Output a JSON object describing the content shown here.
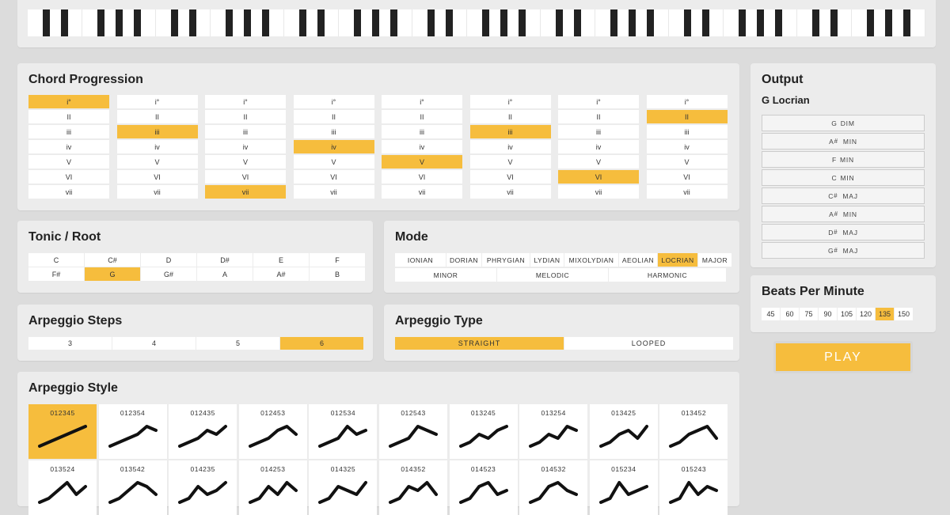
{
  "chord_progression": {
    "title": "Chord Progression",
    "degrees": [
      "i°",
      "II",
      "iii",
      "iv",
      "V",
      "VI",
      "vii"
    ],
    "selected": [
      0,
      2,
      6,
      3,
      4,
      2,
      5,
      1
    ]
  },
  "tonic": {
    "title": "Tonic / Root",
    "notes": [
      "C",
      "C#",
      "D",
      "D#",
      "E",
      "F",
      "F#",
      "G",
      "G#",
      "A",
      "A#",
      "B"
    ],
    "selected": 7
  },
  "mode": {
    "title": "Mode",
    "row1": [
      "IONIAN",
      "DORIAN",
      "PHRYGIAN",
      "LYDIAN",
      "MIXOLYDIAN",
      "AEOLIAN",
      "LOCRIAN",
      "MAJOR"
    ],
    "row2": [
      "MINOR",
      "MELODIC",
      "HARMONIC"
    ],
    "selected": "LOCRIAN"
  },
  "output": {
    "title": "Output",
    "key_name": "G Locrian",
    "chords": [
      {
        "root": "G",
        "accidental": "",
        "quality": "DIM"
      },
      {
        "root": "A",
        "accidental": "#",
        "quality": "MIN"
      },
      {
        "root": "F",
        "accidental": "",
        "quality": "MIN"
      },
      {
        "root": "C",
        "accidental": "",
        "quality": "MIN"
      },
      {
        "root": "C",
        "accidental": "#",
        "quality": "MAJ"
      },
      {
        "root": "A",
        "accidental": "#",
        "quality": "MIN"
      },
      {
        "root": "D",
        "accidental": "#",
        "quality": "MAJ"
      },
      {
        "root": "G",
        "accidental": "#",
        "quality": "MAJ"
      }
    ]
  },
  "bpm": {
    "title": "Beats Per Minute",
    "values": [
      "45",
      "60",
      "75",
      "90",
      "105",
      "120",
      "135",
      "150"
    ],
    "selected": "135"
  },
  "play": {
    "label": "PLAY"
  },
  "arp_steps": {
    "title": "Arpeggio Steps",
    "options": [
      "3",
      "4",
      "5",
      "6"
    ],
    "selected": "6"
  },
  "arp_type": {
    "title": "Arpeggio Type",
    "options": [
      "STRAIGHT",
      "LOOPED"
    ],
    "selected": "STRAIGHT"
  },
  "arp_style": {
    "title": "Arpeggio Style",
    "patterns": [
      "012345",
      "012354",
      "012435",
      "012453",
      "012534",
      "012543",
      "013245",
      "013254",
      "013425",
      "013452",
      "013524",
      "013542",
      "014235",
      "014253",
      "014325",
      "014352",
      "014523",
      "014532",
      "015234",
      "015243"
    ],
    "selected": "012345"
  },
  "colors": {
    "accent": "#f6bd3d",
    "panel": "#ececec",
    "background": "#dcdcdc"
  }
}
